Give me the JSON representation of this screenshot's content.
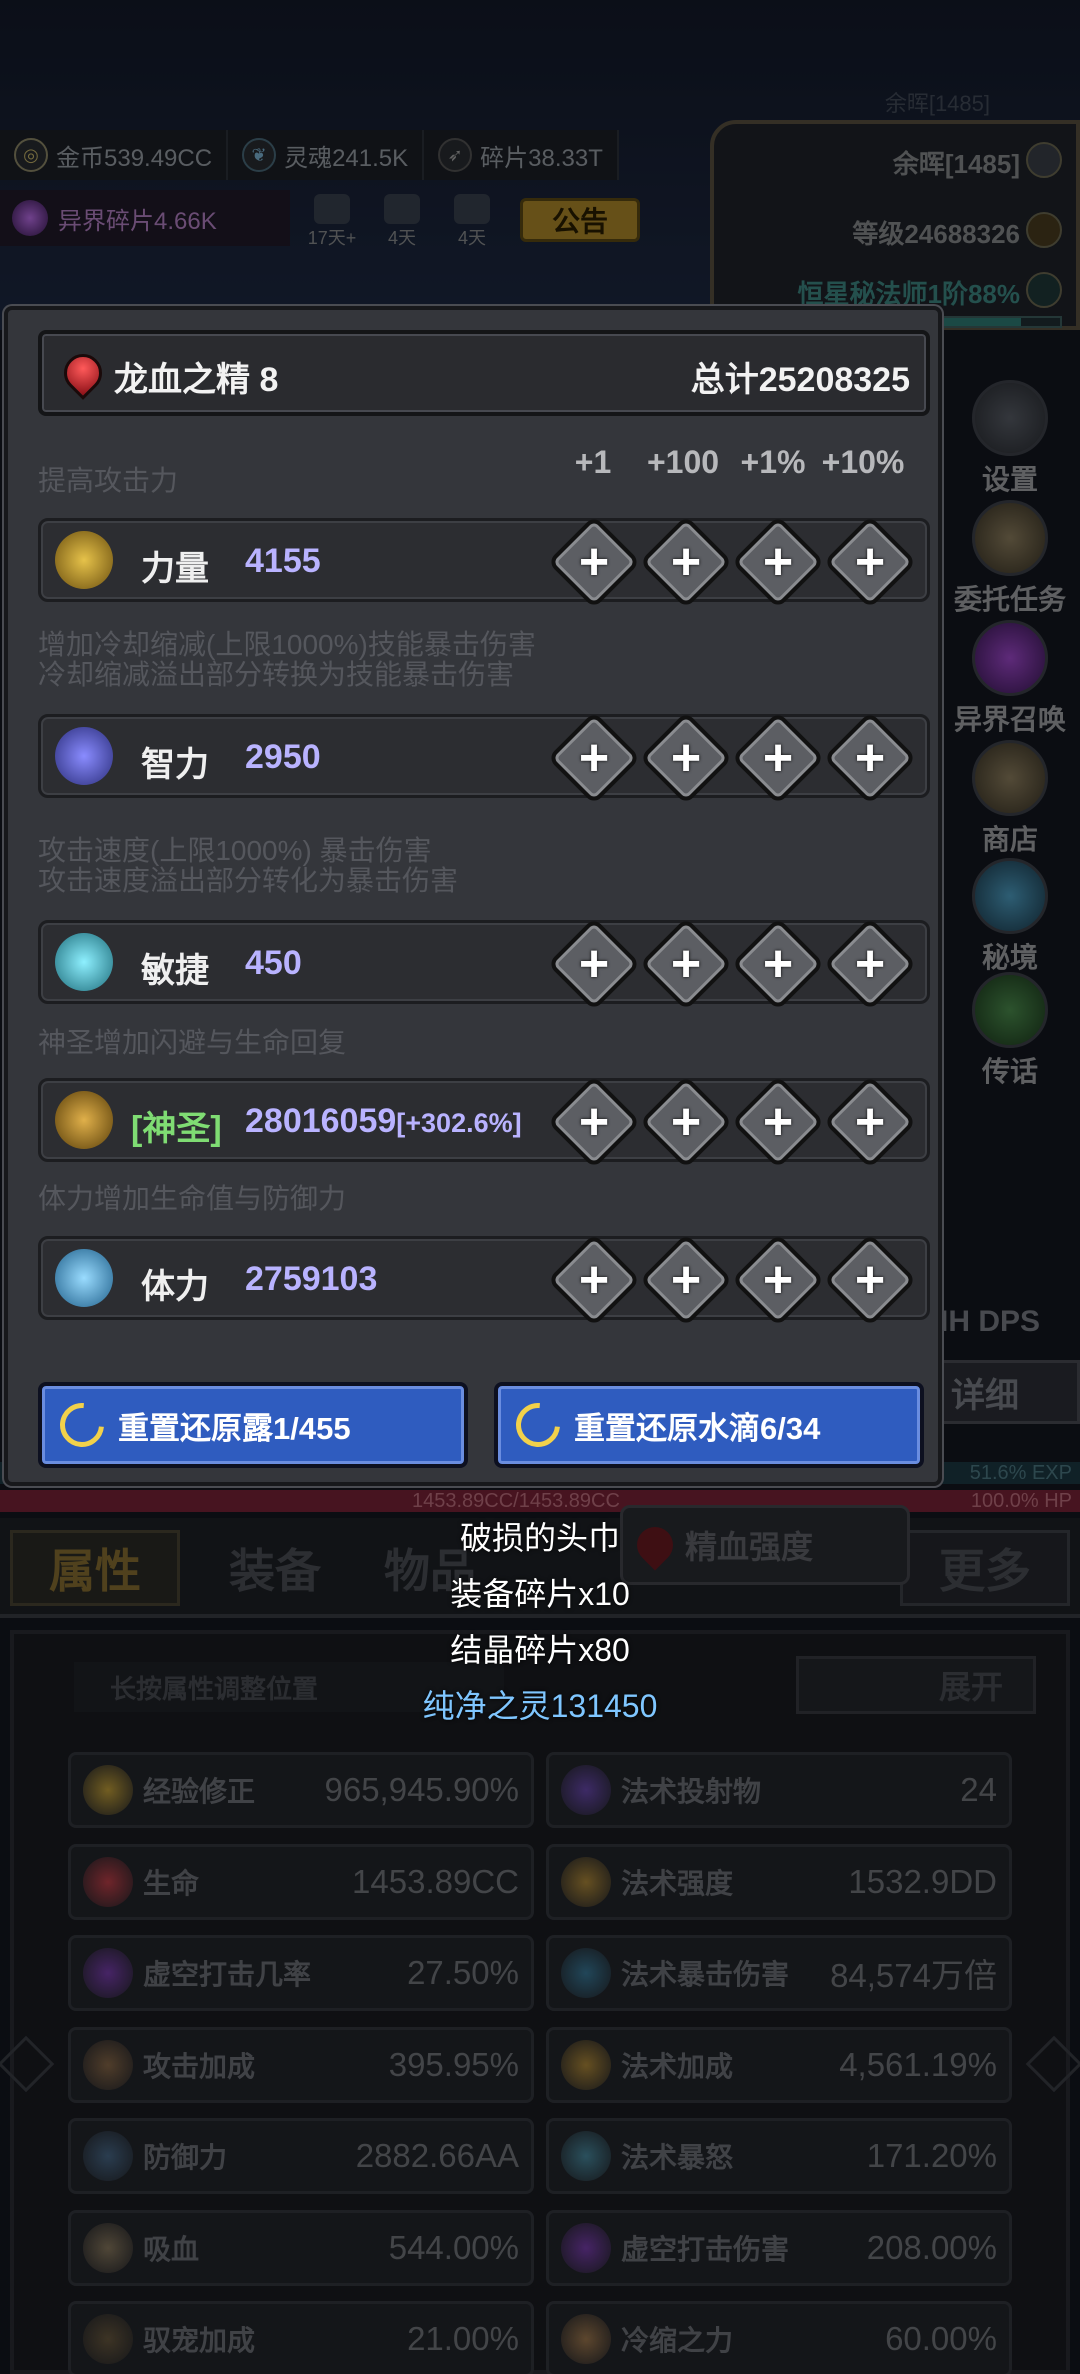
{
  "hud": {
    "ghost_top": "余晖[1485]",
    "gold": "金币539.49CC",
    "soul": "灵魂241.5K",
    "shard": "碎片38.33T",
    "other_shard": "异界碎片4.66K",
    "timers": [
      "17天+",
      "4天",
      "4天"
    ],
    "notice": "公告",
    "afterglow": "余晖[1485]",
    "level": "等级24688326",
    "star_class": "恒星秘法师1阶88%",
    "star_progress": 0.88
  },
  "side_menu": [
    "设置",
    "委托任务",
    "异界召唤",
    "商店",
    "秘境",
    "传话"
  ],
  "dps_label": "IH DPS",
  "detail_label": "详细",
  "exp_text": "51.6% EXP",
  "hp_text": "100.0% HP",
  "hp_value": "1453.89CC/1453.89CC",
  "popup": {
    "title": "龙血之精 8",
    "total": "总计25208325",
    "columns": [
      "+1",
      "+100",
      "+1%",
      "+10%"
    ],
    "desc_strength": "提高攻击力",
    "desc_int_1": "增加冷却缩减(上限1000%)技能暴击伤害",
    "desc_int_2": "冷却缩减溢出部分转换为技能暴击伤害",
    "desc_agi_1": "攻击速度(上限1000%) 暴击伤害",
    "desc_agi_2": "攻击速度溢出部分转化为暴击伤害",
    "desc_holy": "神圣增加闪避与生命回复",
    "desc_vit": "体力增加生命值与防御力",
    "strength": {
      "name": "力量",
      "value": "4155"
    },
    "intellect": {
      "name": "智力",
      "value": "2950"
    },
    "agility": {
      "name": "敏捷",
      "value": "450"
    },
    "holy": {
      "name": "[神圣]",
      "value": "28016059",
      "bonus": "[+302.6%]"
    },
    "vitality": {
      "name": "体力",
      "value": "2759103"
    },
    "plus_symbol": "+",
    "reset_dew": "重置还原露1/455",
    "reset_drop": "重置还原水滴6/34"
  },
  "rewards": [
    "破损的头巾",
    "装备碎片x10",
    "结晶碎片x80",
    "纯净之灵131450"
  ],
  "tabs": [
    "属性",
    "装备",
    "物品",
    "更多"
  ],
  "essence_pill": "精血强度",
  "stats": {
    "hint": "长按属性调整位置",
    "expand": "展开",
    "left": [
      {
        "name": "经验修正",
        "value": "965,945.90%"
      },
      {
        "name": "生命",
        "value": "1453.89CC"
      },
      {
        "name": "虚空打击几率",
        "value": "27.50%"
      },
      {
        "name": "攻击加成",
        "value": "395.95%"
      },
      {
        "name": "防御力",
        "value": "2882.66AA"
      },
      {
        "name": "吸血",
        "value": "544.00%"
      },
      {
        "name": "驭宠加成",
        "value": "21.00%"
      }
    ],
    "right": [
      {
        "name": "法术投射物",
        "value": "24"
      },
      {
        "name": "法术强度",
        "value": "1532.9DD"
      },
      {
        "name": "法术暴击伤害",
        "value": "84,574万倍"
      },
      {
        "name": "法术加成",
        "value": "4,561.19%"
      },
      {
        "name": "法术暴怒",
        "value": "171.20%"
      },
      {
        "name": "虚空打击伤害",
        "value": "208.00%"
      },
      {
        "name": "冷缩之力",
        "value": "60.00%"
      }
    ]
  },
  "colors": {
    "holy_green": "#7fdc73",
    "value_purple": "#b9b3ff",
    "reset_blue": "#2f5cbf",
    "reward_blue": "#7fc6ff"
  }
}
